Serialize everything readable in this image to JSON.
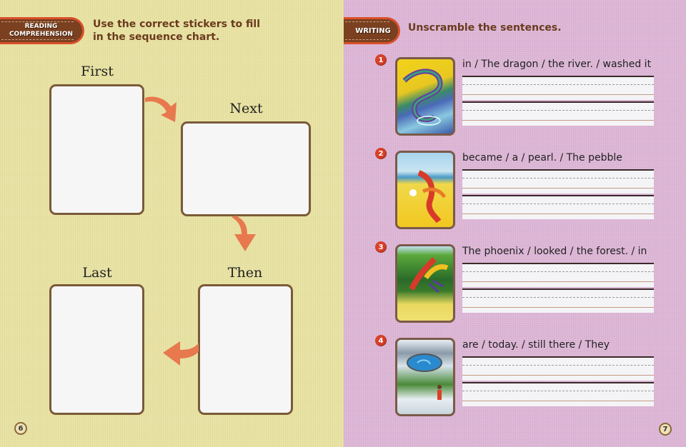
{
  "left_page": {
    "section_tag": [
      "READING",
      "COMPREHENSION"
    ],
    "instruction": "Use the correct stickers to fill in the sequence chart.",
    "sequence_boxes": [
      {
        "label": "First"
      },
      {
        "label": "Next"
      },
      {
        "label": "Then"
      },
      {
        "label": "Last"
      }
    ],
    "page_number": "6"
  },
  "right_page": {
    "section_tag": "WRITING",
    "instruction": "Unscramble the sentences.",
    "items": [
      {
        "number": "1",
        "image": "dragon-river-illustration",
        "scrambled": "in / The dragon / the river. / washed it"
      },
      {
        "number": "2",
        "image": "phoenix-pearl-illustration",
        "scrambled": "became / a / pearl. / The pebble"
      },
      {
        "number": "3",
        "image": "phoenix-forest-illustration",
        "scrambled": "The phoenix / looked / the forest. / in"
      },
      {
        "number": "4",
        "image": "lake-mountain-illustration",
        "scrambled": "are / today. / still there / They"
      }
    ],
    "page_number": "7"
  },
  "colors": {
    "left_bg": "#e8e2a2",
    "right_bg": "#ddb6d6",
    "tag_fill": "#7a4020",
    "tag_border": "#d9502a",
    "arrow": "#e8784e",
    "number_badge": "#d9412a",
    "instruction_text": "#6a3a1e"
  }
}
